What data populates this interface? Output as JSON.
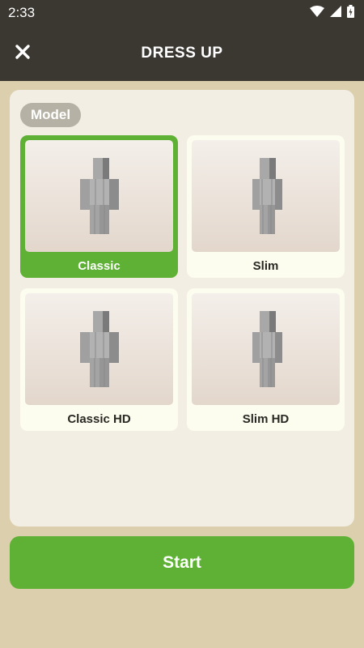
{
  "status_bar": {
    "time": "2:33",
    "icons": [
      "wifi-icon",
      "signal-icon",
      "battery-icon"
    ]
  },
  "header": {
    "title": "DRESS UP",
    "close_icon": "close-icon"
  },
  "model_section": {
    "label": "Model",
    "selected": "Classic",
    "options": [
      {
        "label": "Classic",
        "selected": true,
        "icon": "classic-model-figure"
      },
      {
        "label": "Slim",
        "selected": false,
        "icon": "slim-model-figure"
      },
      {
        "label": "Classic HD",
        "selected": false,
        "icon": "classic-hd-model-figure"
      },
      {
        "label": "Slim HD",
        "selected": false,
        "icon": "slim-hd-model-figure"
      }
    ]
  },
  "start_button": {
    "label": "Start"
  },
  "colors": {
    "header_bg": "#3b3832",
    "page_bg": "#dbcfae",
    "panel_bg": "#f2eee3",
    "accent_green": "#5eb134",
    "card_bg": "#fcfcef",
    "badge_bg": "#b5b1a4"
  }
}
